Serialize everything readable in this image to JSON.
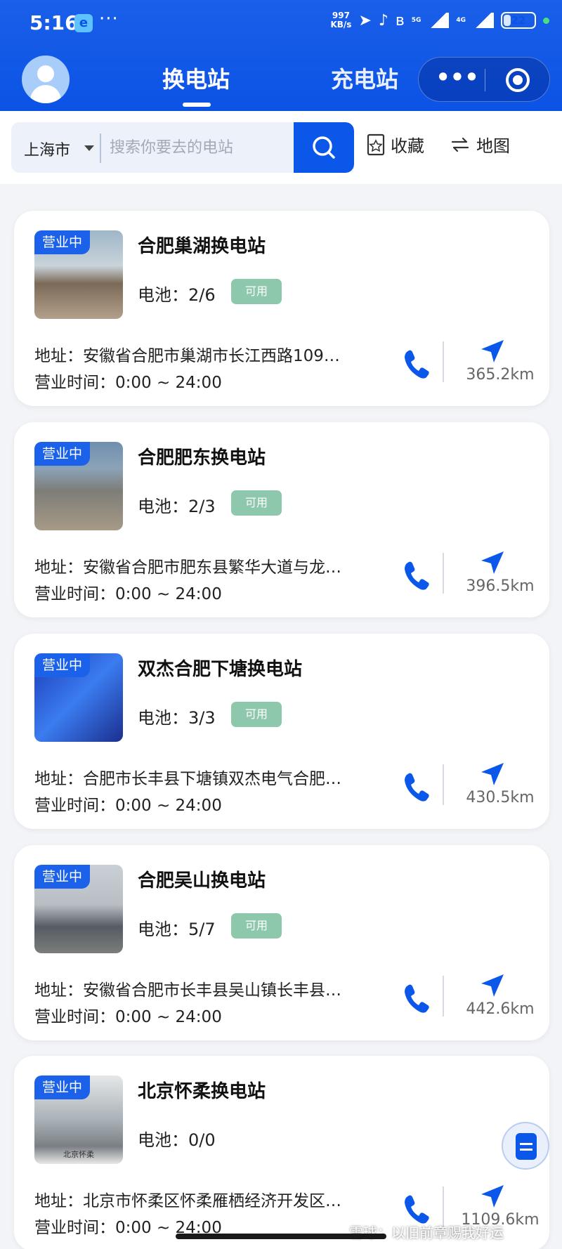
{
  "statusbar": {
    "time": "5:16",
    "app_icon_text": "e",
    "dots": "···",
    "net_speed": "997",
    "net_unit": "KB/s",
    "sig1": "5G",
    "sig2": "4G",
    "battery": "22"
  },
  "header": {
    "tabs": [
      {
        "label": "换电站",
        "active": true
      },
      {
        "label": "充电站",
        "active": false
      }
    ],
    "more_label": "•••"
  },
  "search": {
    "city": "上海市",
    "placeholder": "搜索你要去的电站",
    "favorites_label": "收藏",
    "map_label": "地图"
  },
  "colors": {
    "primary": "#0b57ea",
    "available_badge": "#8ec8ac",
    "header_bg": "#1a5fe8"
  },
  "stations": [
    {
      "status": "营业中",
      "name": "合肥巢湖换电站",
      "battery_label": "电池：",
      "battery": "2/6",
      "available": "可用",
      "address": "地址：安徽省合肥市巢湖市长江西路109…",
      "hours": "营业时间：0:00 ~ 24:00",
      "distance": "365.2km"
    },
    {
      "status": "营业中",
      "name": "合肥肥东换电站",
      "battery_label": "电池：",
      "battery": "2/3",
      "available": "可用",
      "address": "地址：安徽省合肥市肥东县繁华大道与龙…",
      "hours": "营业时间：0:00 ~ 24:00",
      "distance": "396.5km"
    },
    {
      "status": "营业中",
      "name": "双杰合肥下塘换电站",
      "battery_label": "电池：",
      "battery": "3/3",
      "available": "可用",
      "address": "地址：合肥市长丰县下塘镇双杰电气合肥…",
      "hours": "营业时间：0:00 ~ 24:00",
      "distance": "430.5km"
    },
    {
      "status": "营业中",
      "name": "合肥吴山换电站",
      "battery_label": "电池：",
      "battery": "5/7",
      "available": "可用",
      "address": "地址：安徽省合肥市长丰县吴山镇长丰县…",
      "hours": "营业时间：0:00 ~ 24:00",
      "distance": "442.6km"
    },
    {
      "status": "营业中",
      "name": "北京怀柔换电站",
      "battery_label": "电池：",
      "battery": "0/0",
      "thumb_caption": "北京怀柔",
      "address": "地址：北京市怀柔区怀柔雁栖经济开发区…",
      "hours": "营业时间：0:00 ~ 24:00",
      "distance": "1109.6km"
    }
  ],
  "watermark": "雪球：以旧前章赐我好运"
}
